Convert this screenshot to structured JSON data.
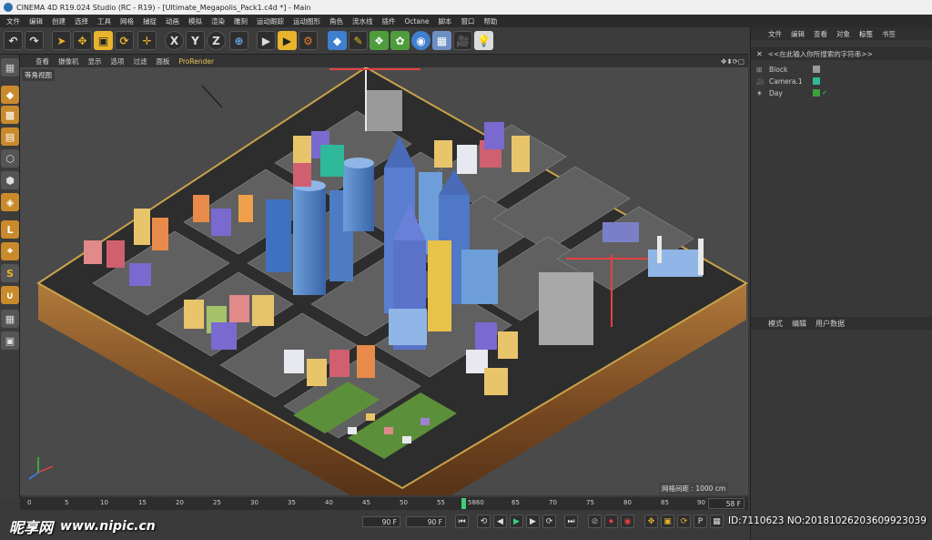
{
  "window": {
    "title": "CINEMA 4D R19.024 Studio (RC - R19) - [Ultimate_Megapolis_Pack1.c4d *] - Main"
  },
  "menu": [
    "文件",
    "编辑",
    "创建",
    "选择",
    "工具",
    "网格",
    "捕捉",
    "动画",
    "模拟",
    "渲染",
    "雕刻",
    "运动跟踪",
    "运动图形",
    "角色",
    "流水线",
    "插件",
    "Octane",
    "脚本",
    "窗口",
    "帮助"
  ],
  "toolbar": {
    "axis_x": "X",
    "axis_y": "Y",
    "axis_z": "Z",
    "icons": [
      "undo-icon",
      "redo-icon",
      "select-icon",
      "move-icon",
      "scale-icon",
      "rotate-icon",
      "transform-icon",
      "x-axis-icon",
      "y-axis-icon",
      "z-axis-icon",
      "coordinate-icon",
      "render-view-icon",
      "render-icon",
      "render-settings-icon",
      "cube-icon",
      "pen-icon",
      "subdivision-icon",
      "cloner-icon",
      "deformer-icon",
      "floor-icon",
      "camera-icon",
      "light-icon"
    ]
  },
  "viewport_menu": [
    "查看",
    "摄像机",
    "显示",
    "选项",
    "过滤",
    "面板"
  ],
  "viewport_menu_pr": "ProRender",
  "viewport": {
    "view_label": "等角视图",
    "grid_spacing": "网格间距 : 1000 cm"
  },
  "timeline": {
    "ticks": [
      "0",
      "5",
      "10",
      "15",
      "20",
      "25",
      "30",
      "35",
      "40",
      "45",
      "50",
      "55",
      "5860",
      "65",
      "70",
      "75",
      "80",
      "85",
      "90"
    ],
    "end_frame": "58 F",
    "field_a": "90 F",
    "field_b": "90 F"
  },
  "right_panel": {
    "tabs": [
      "文件",
      "编辑",
      "查看",
      "对象",
      "标签",
      "书签"
    ],
    "active_tab": "标签",
    "search_placeholder": "<<在此输入你所搜索的字符串>>",
    "objects": [
      {
        "name": "Block",
        "color": "#9a9a9a"
      },
      {
        "name": "Camera.1",
        "color": "#2fb89a"
      },
      {
        "name": "Day",
        "color": "#3aa040"
      }
    ],
    "attr_tabs": [
      "模式",
      "编辑",
      "用户数据"
    ]
  },
  "watermark": {
    "cn": "昵享网",
    "url": "www.nipic.cn"
  },
  "image_id": "ID:7110623 NO:20181026203609923039"
}
